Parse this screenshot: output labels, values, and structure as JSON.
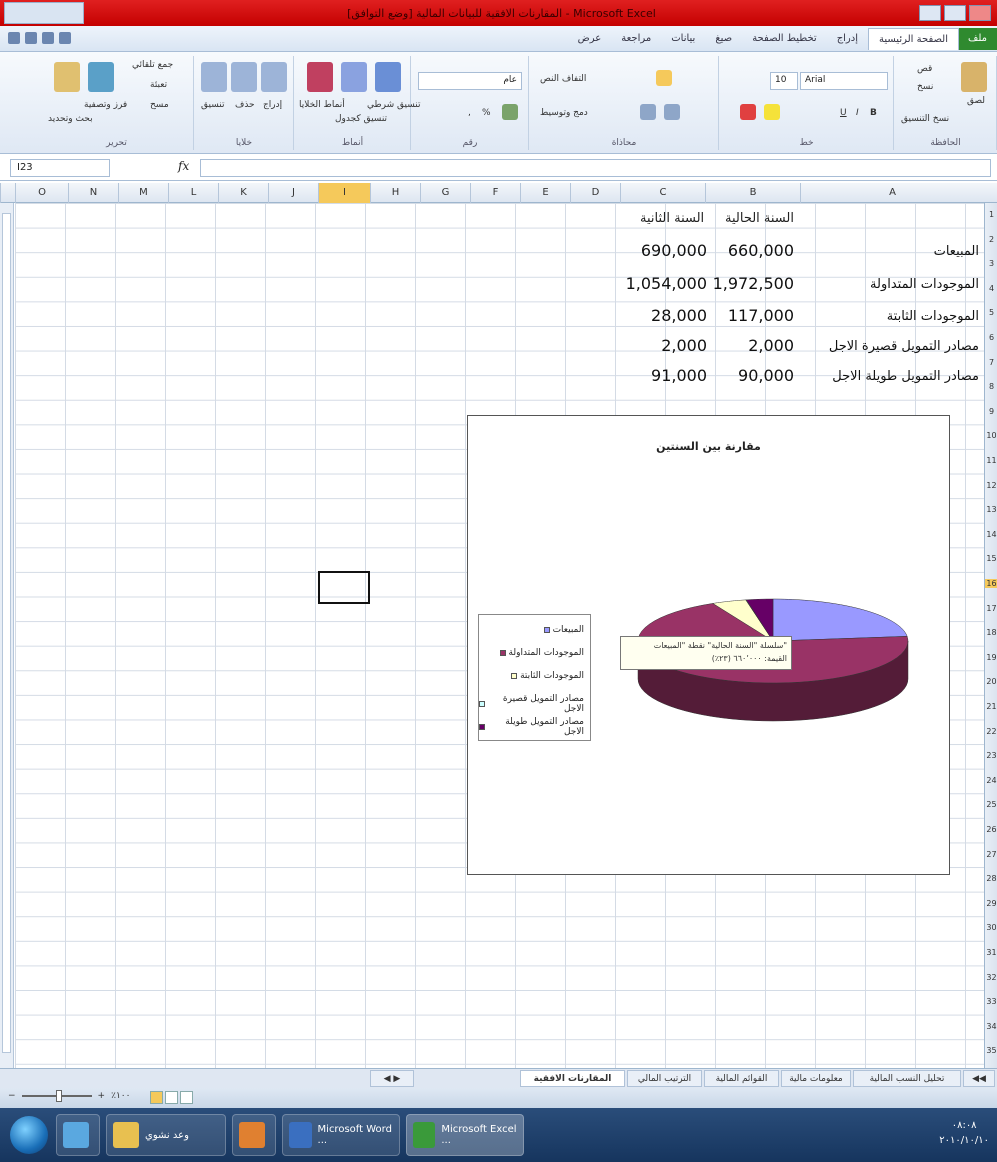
{
  "window": {
    "title": "المقارنات الافقية للبيانات المالية [وضع التوافق] - Microsoft Excel"
  },
  "ribbon": {
    "tabs": [
      "ملف",
      "الصفحة الرئيسية",
      "إدراج",
      "تخطيط الصفحة",
      "صيغ",
      "بيانات",
      "مراجعة",
      "عرض"
    ],
    "active_tab": "الصفحة الرئيسية",
    "font_name": "Arial",
    "font_size": "10",
    "number_format": "عام",
    "group_labels": [
      "الحافظة",
      "خط",
      "محاذاة",
      "رقم",
      "أنماط",
      "خلايا",
      "تحرير"
    ],
    "wrap_text": "التفاف النص",
    "merge_center": "دمج وتوسيط",
    "paste": "لصق",
    "cut": "قص",
    "copy": "نسخ",
    "format_painter": "نسخ التنسيق",
    "conditional_formatting": "تنسيق شرطي",
    "format_as_table": "تنسيق كجدول",
    "cell_styles": "أنماط الخلايا",
    "insert": "إدراج",
    "delete": "حذف",
    "format": "تنسيق",
    "autosum": "جمع تلقائي",
    "fill": "تعبئة",
    "clear": "مسح",
    "sort_filter": "فرز وتصفية",
    "find_select": "بحث وتحديد"
  },
  "formula_bar": {
    "name_box": "I23",
    "fx": "fx",
    "value": ""
  },
  "columns": [
    "A",
    "B",
    "C",
    "D",
    "E",
    "F",
    "G",
    "H",
    "I",
    "J",
    "K",
    "L",
    "M",
    "N",
    "O"
  ],
  "selected_column": "I",
  "sheet": {
    "header_b": "السنة الحالية",
    "header_c": "السنة الثانية",
    "rows": [
      {
        "label": "المبيعات",
        "b": "660,000",
        "c": "690,000"
      },
      {
        "label": "الموجودات المتداولة",
        "b": "1,972,500",
        "c": "1,054,000"
      },
      {
        "label": "الموجودات الثابتة",
        "b": "117,000",
        "c": "28,000"
      },
      {
        "label": "مصادر التمويل قصيرة الاجل",
        "b": "2,000",
        "c": "2,000"
      },
      {
        "label": "مصادر التمويل طويلة الاجل",
        "b": "90,000",
        "c": "91,000"
      }
    ]
  },
  "chart_data": {
    "type": "pie",
    "title": "مقارنة بين السنتين",
    "categories": [
      "المبيعات",
      "الموجودات المتداولة",
      "الموجودات الثابتة",
      "مصادر التمويل قصيرة الاجل",
      "مصادر التمويل طويلة الاجل"
    ],
    "series": [
      {
        "name": "السنة الحالية",
        "values": [
          660000,
          1972500,
          117000,
          2000,
          90000
        ]
      }
    ],
    "colors": [
      "#9999ff",
      "#993366",
      "#ffffcc",
      "#ccffff",
      "#660066"
    ],
    "legend": "left",
    "tooltip": [
      "سلسلة \"السنة الحالية\" نقطة \"المبيعات\"",
      "القيمة: ٦٦٠٬٠٠٠ (٢٣٪)"
    ]
  },
  "sheet_tabs": [
    "المقارنات الافقية",
    "الترتيب المالي",
    "القوائم المالية",
    "معلومات مالية",
    "تحليل النسب المالية"
  ],
  "active_sheet": "المقارنات الافقية",
  "status": {
    "zoom": "٪١٠٠"
  },
  "taskbar": {
    "items": [
      "وعد نشوي",
      "Microsoft Word ...",
      "Microsoft Excel ..."
    ],
    "time": "٠٨:٠٨",
    "date": "٢٠١٠/١٠/١٠"
  }
}
